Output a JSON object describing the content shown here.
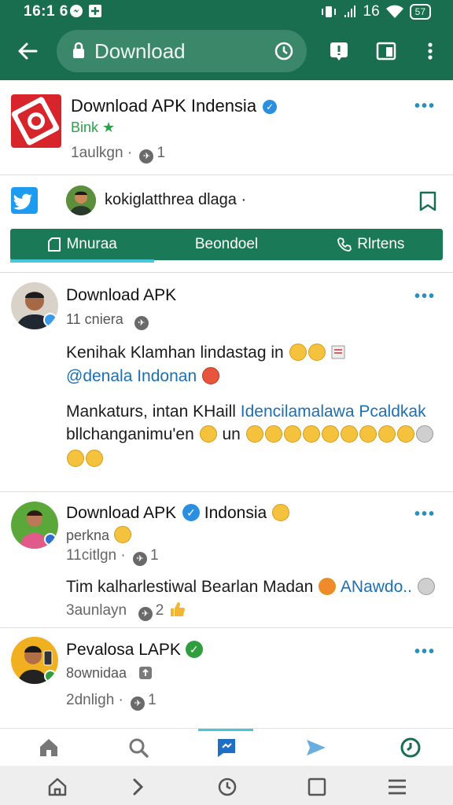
{
  "status_bar": {
    "time": "16:1 6",
    "network": "16",
    "battery": "57"
  },
  "toolbar": {
    "url": "Download"
  },
  "header_card": {
    "title": "Download APK Indensia",
    "bink": "Bink",
    "meta_time": "1aulkgn",
    "meta_count": "1",
    "share_user": "kokiglatthrea dlaga"
  },
  "tabs": [
    {
      "label": "Mnuraa"
    },
    {
      "label": "Beondoel"
    },
    {
      "label": "Rlrtens"
    }
  ],
  "posts": [
    {
      "name": "Download APK",
      "time": "11 cniera",
      "line1": "Kenihak Klamhan lindastag in",
      "mention": "@denala Indonan",
      "line2": "Mankaturs,  intan KHaill",
      "line2_blue": "Idencilamalawa Pcaldkak",
      "line3": "bllchanganimu'en",
      "line3_b": "un"
    },
    {
      "name": "Download APK",
      "name_b": "Indonsia",
      "sub": "perkna",
      "time": "11citlgn",
      "count": "1",
      "text": "Tim kalharlestiwal Bearlan Madan",
      "text_blue": "ANawdo..",
      "meta_time": "3aunlayn",
      "meta_count": "2"
    },
    {
      "name": "Pevalosa LAPK",
      "sub": "8ownidaa",
      "time": "2dnligh",
      "count": "1"
    }
  ],
  "colors": {
    "brand_green": "#1a6e50",
    "tab_green": "#1a7a58",
    "link_blue": "#2a8fbf"
  }
}
